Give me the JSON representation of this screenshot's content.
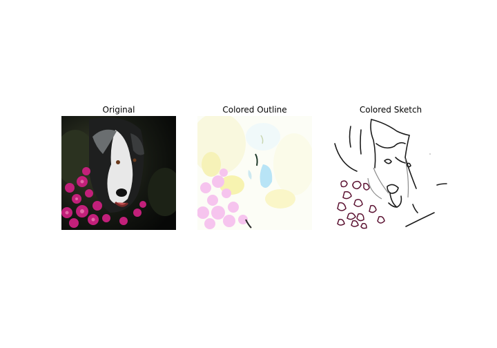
{
  "panels": [
    {
      "title": "Original"
    },
    {
      "title": "Colored Outline"
    },
    {
      "title": "Colored Sketch"
    }
  ],
  "colors": {
    "background": "#ffffff",
    "flower_magenta": "#c2207a",
    "sketch_stroke": "#1a1a1a",
    "sketch_flower": "#5a1030",
    "outline_pink": "#f6c4ee",
    "outline_yellow": "#f7f3b0",
    "outline_blue": "#b8e4f6"
  }
}
